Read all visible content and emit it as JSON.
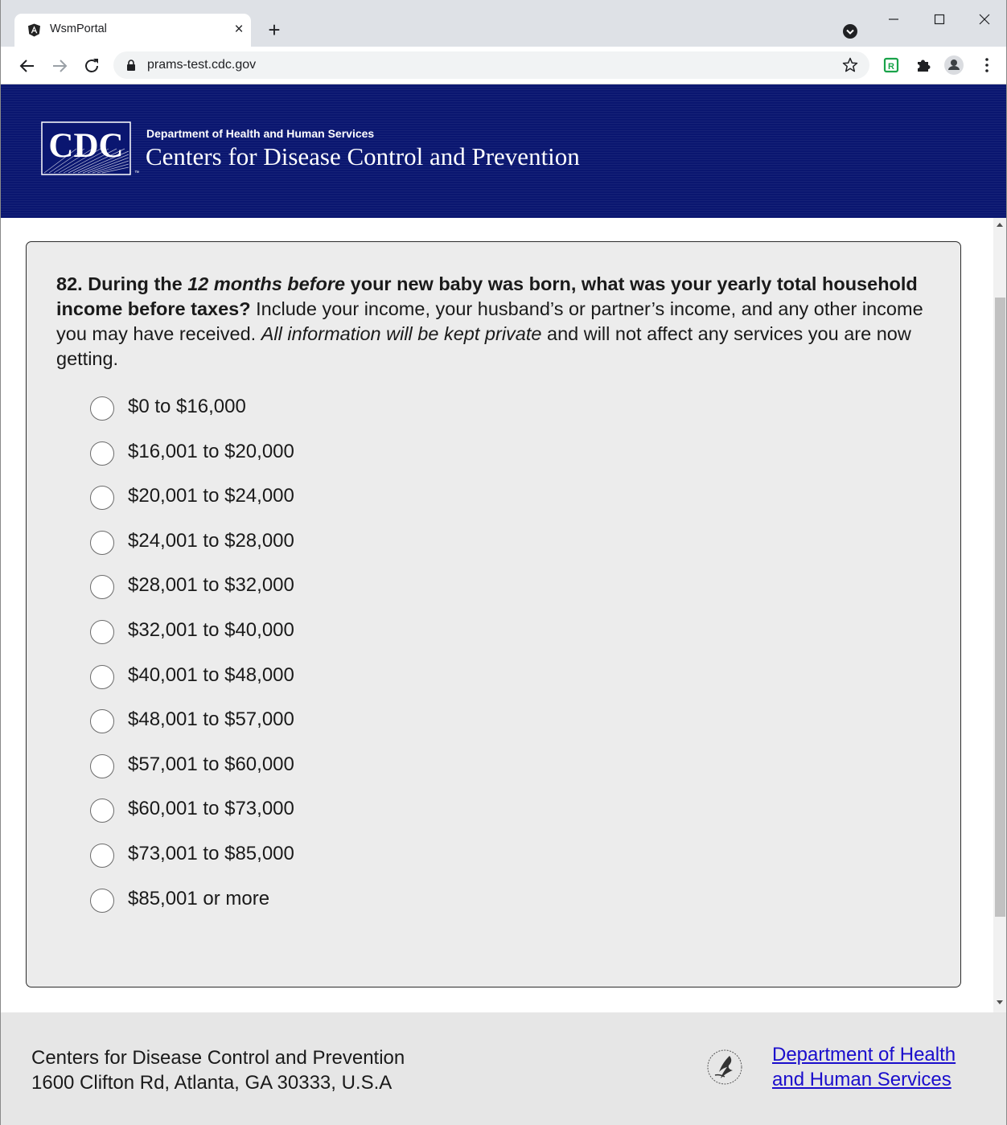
{
  "browser": {
    "tab_title": "WsmPortal",
    "tab_close": "×",
    "new_tab": "+",
    "url": "prams-test.cdc.gov"
  },
  "header": {
    "logo_text": "CDC",
    "department": "Department of Health and Human Services",
    "agency": "Centers for Disease Control and Prevention"
  },
  "question": {
    "number": "82.",
    "part1_bold": "During the ",
    "part2_bolditalic": "12 months before",
    "part3_bold": " your new baby was born, what was your yearly total household income before taxes?",
    "part4": " Include your income, your husband’s or partner’s income, and any other income you may have received. ",
    "part5_italic": "All information will be kept private",
    "part6": " and will not affect any services you are now getting.",
    "options": [
      "$0 to $16,000",
      "$16,001 to $20,000",
      "$20,001 to $24,000",
      "$24,001 to $28,000",
      "$28,001 to $32,000",
      "$32,001 to $40,000",
      "$40,001 to $48,000",
      "$48,001 to $57,000",
      "$57,001 to $60,000",
      "$60,001 to $73,000",
      "$73,001 to $85,000",
      "$85,001 or more"
    ]
  },
  "footer": {
    "line1": "Centers for Disease Control and Prevention",
    "line2": "1600 Clifton Rd, Atlanta, GA 30333, U.S.A",
    "hhs_link": "Department of Health and Human Services"
  },
  "colors": {
    "header_bg": "#0a1670",
    "card_bg": "#ececec",
    "link": "#1a0dcc"
  }
}
